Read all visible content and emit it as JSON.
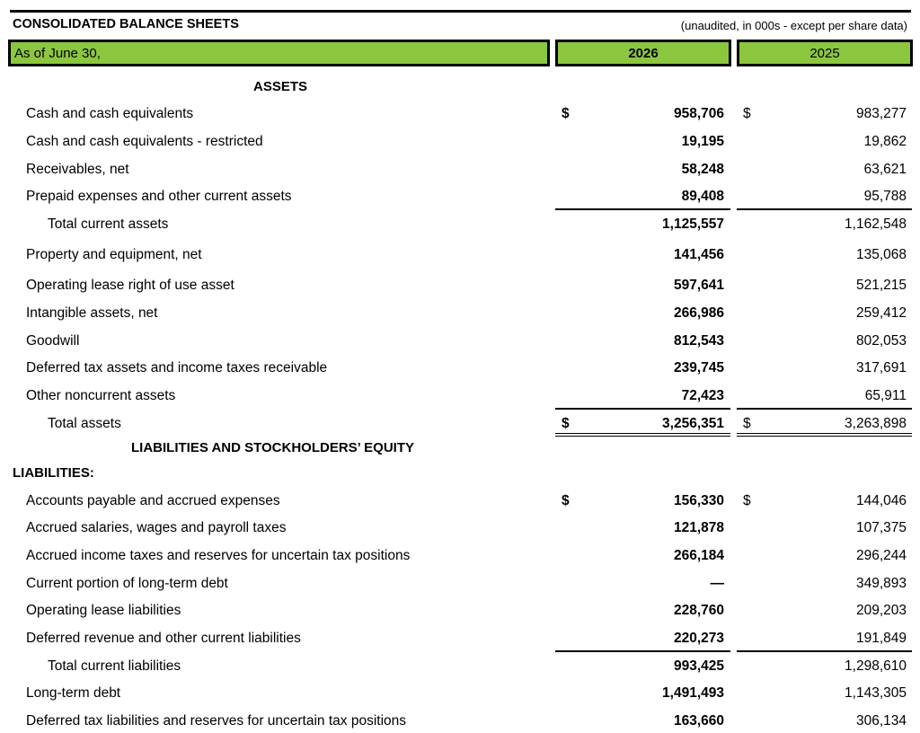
{
  "header": {
    "title": "CONSOLIDATED BALANCE SHEETS",
    "subtitle": "(unaudited, in 000s - except per share data)",
    "as_of": "As of June 30,",
    "year1": "2026",
    "year2": "2025"
  },
  "sections": {
    "assets": "ASSETS",
    "liab_equity": "LIABILITIES AND STOCKHOLDERS’ EQUITY",
    "liabilities": "LIABILITIES:"
  },
  "currency_symbol": "$",
  "rows": [
    {
      "label": "Cash and cash equivalents",
      "v2026": "958,706",
      "v2025": "983,277",
      "dollar": true
    },
    {
      "label": "Cash and cash equivalents - restricted",
      "v2026": "19,195",
      "v2025": "19,862"
    },
    {
      "label": "Receivables, net",
      "v2026": "58,248",
      "v2025": "63,621"
    },
    {
      "label": "Prepaid expenses and other current assets",
      "v2026": "89,408",
      "v2025": "95,788"
    },
    {
      "label": "Total current assets",
      "v2026": "1,125,557",
      "v2025": "1,162,548",
      "indent": true
    },
    {
      "label": "Property and equipment, net",
      "v2026": "141,456",
      "v2025": "135,068"
    },
    {
      "label": "Operating lease right of use asset",
      "v2026": "597,641",
      "v2025": "521,215"
    },
    {
      "label": "Intangible assets, net",
      "v2026": "266,986",
      "v2025": "259,412"
    },
    {
      "label": "Goodwill",
      "v2026": "812,543",
      "v2025": "802,053"
    },
    {
      "label": "Deferred tax assets and income taxes receivable",
      "v2026": "239,745",
      "v2025": "317,691"
    },
    {
      "label": "Other noncurrent assets",
      "v2026": "72,423",
      "v2025": "65,911"
    },
    {
      "label": "Total assets",
      "v2026": "3,256,351",
      "v2025": "3,263,898",
      "indent": true,
      "dollar": true
    },
    {
      "label": "Accounts payable and accrued expenses",
      "v2026": "156,330",
      "v2025": "144,046",
      "dollar": true
    },
    {
      "label": "Accrued salaries, wages and payroll taxes",
      "v2026": "121,878",
      "v2025": "107,375"
    },
    {
      "label": "Accrued income taxes and reserves for uncertain tax positions",
      "v2026": "266,184",
      "v2025": "296,244"
    },
    {
      "label": "Current portion of long-term debt",
      "v2026": "—",
      "v2025": "349,893"
    },
    {
      "label": "Operating lease liabilities",
      "v2026": "228,760",
      "v2025": "209,203"
    },
    {
      "label": "Deferred revenue and other current liabilities",
      "v2026": "220,273",
      "v2025": "191,849"
    },
    {
      "label": "Total current liabilities",
      "v2026": "993,425",
      "v2025": "1,298,610",
      "indent": true
    },
    {
      "label": "Long-term debt",
      "v2026": "1,491,493",
      "v2025": "1,143,305"
    },
    {
      "label": "Deferred tax liabilities and reserves for uncertain tax positions",
      "v2026": "163,660",
      "v2025": "306,134"
    }
  ]
}
